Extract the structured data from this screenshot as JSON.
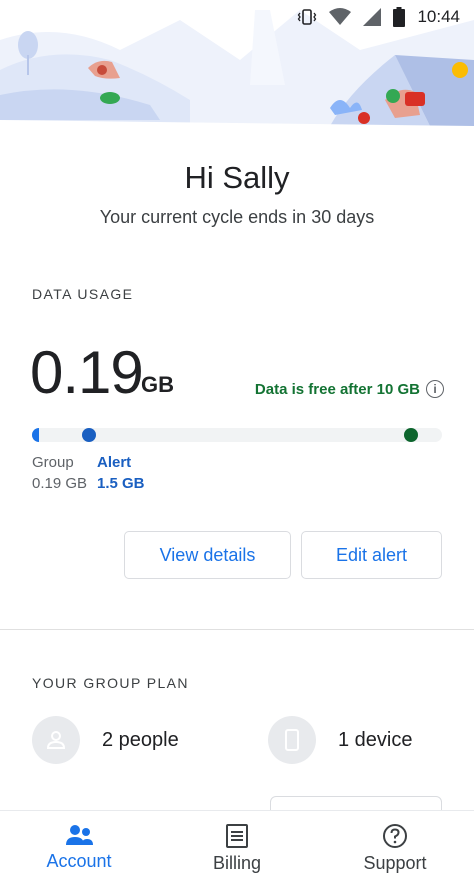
{
  "status_bar": {
    "time": "10:44",
    "icons": [
      "vibrate-icon",
      "wifi-icon",
      "signal-icon",
      "battery-icon"
    ]
  },
  "header": {
    "greeting": "Hi Sally",
    "cycle_text": "Your current cycle ends in 30 days"
  },
  "data_usage": {
    "section_label": "DATA USAGE",
    "amount": "0.19",
    "unit": "GB",
    "free_note": "Data is free after 10 GB",
    "group_label": "Group",
    "group_value": "0.19 GB",
    "alert_label": "Alert",
    "alert_value": "1.5 GB",
    "usage_fraction": 0.019,
    "alert_fraction": 0.15,
    "buttons": {
      "view_details": "View details",
      "edit_alert": "Edit alert"
    }
  },
  "group_plan": {
    "section_label": "YOUR GROUP PLAN",
    "people": "2 people",
    "devices": "1 device"
  },
  "bottom_nav": {
    "items": [
      {
        "label": "Account",
        "icon": "account-icon",
        "active": true
      },
      {
        "label": "Billing",
        "icon": "billing-icon",
        "active": false
      },
      {
        "label": "Support",
        "icon": "support-icon",
        "active": false
      }
    ]
  },
  "colors": {
    "accent": "#1a73e8",
    "free_note": "#137333",
    "limit_dot": "#0d652d"
  }
}
